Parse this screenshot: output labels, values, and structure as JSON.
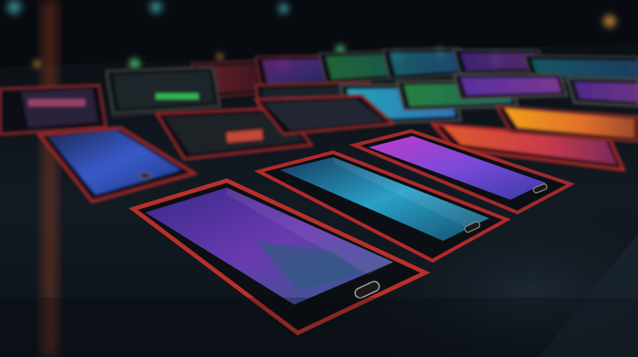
{
  "scene": {
    "subject": "smartphones-on-table",
    "colors": {
      "background": "#05080c",
      "table": "#0c1218",
      "table_highlight": "#1b2530",
      "phone_body": "#0b0f14",
      "phone_rim": "#b02a2a",
      "bokeh_orange": "#d9822b",
      "bokeh_green": "#3ddc6a",
      "bokeh_teal": "#2fb8c4"
    },
    "phones": [
      {
        "screen_colors": [
          "#3a2a8a",
          "#6a3ab0",
          "#2e5f8a"
        ]
      },
      {
        "screen_colors": [
          "#12506e",
          "#2aa0c8",
          "#163a5e"
        ]
      },
      {
        "screen_colors": [
          "#c23ac8",
          "#7a4ad8",
          "#3a3aa8"
        ]
      },
      {
        "screen_colors": [
          "#1c3a8a",
          "#3a5ac8",
          "#1a2a5a"
        ]
      },
      {
        "screen_colors": [
          "#e05a2a",
          "#c83a4a",
          "#7a2a5a"
        ]
      },
      {
        "screen_colors": [
          "#f0a01a",
          "#e0702a",
          "#a04a2a"
        ]
      },
      {
        "screen_colors": [
          "#2ac8e0",
          "#3a8ae0",
          "#2a5aa8"
        ]
      },
      {
        "screen_colors": [
          "#7a3ad8",
          "#a84ac8",
          "#5a2aa8"
        ]
      },
      {
        "screen_colors": [
          "#3ac85a",
          "#2aa890",
          "#1a6a5a"
        ]
      },
      {
        "screen_colors": [
          "#e03a4a",
          "#c82a3a",
          "#7a1a2a"
        ]
      }
    ]
  }
}
